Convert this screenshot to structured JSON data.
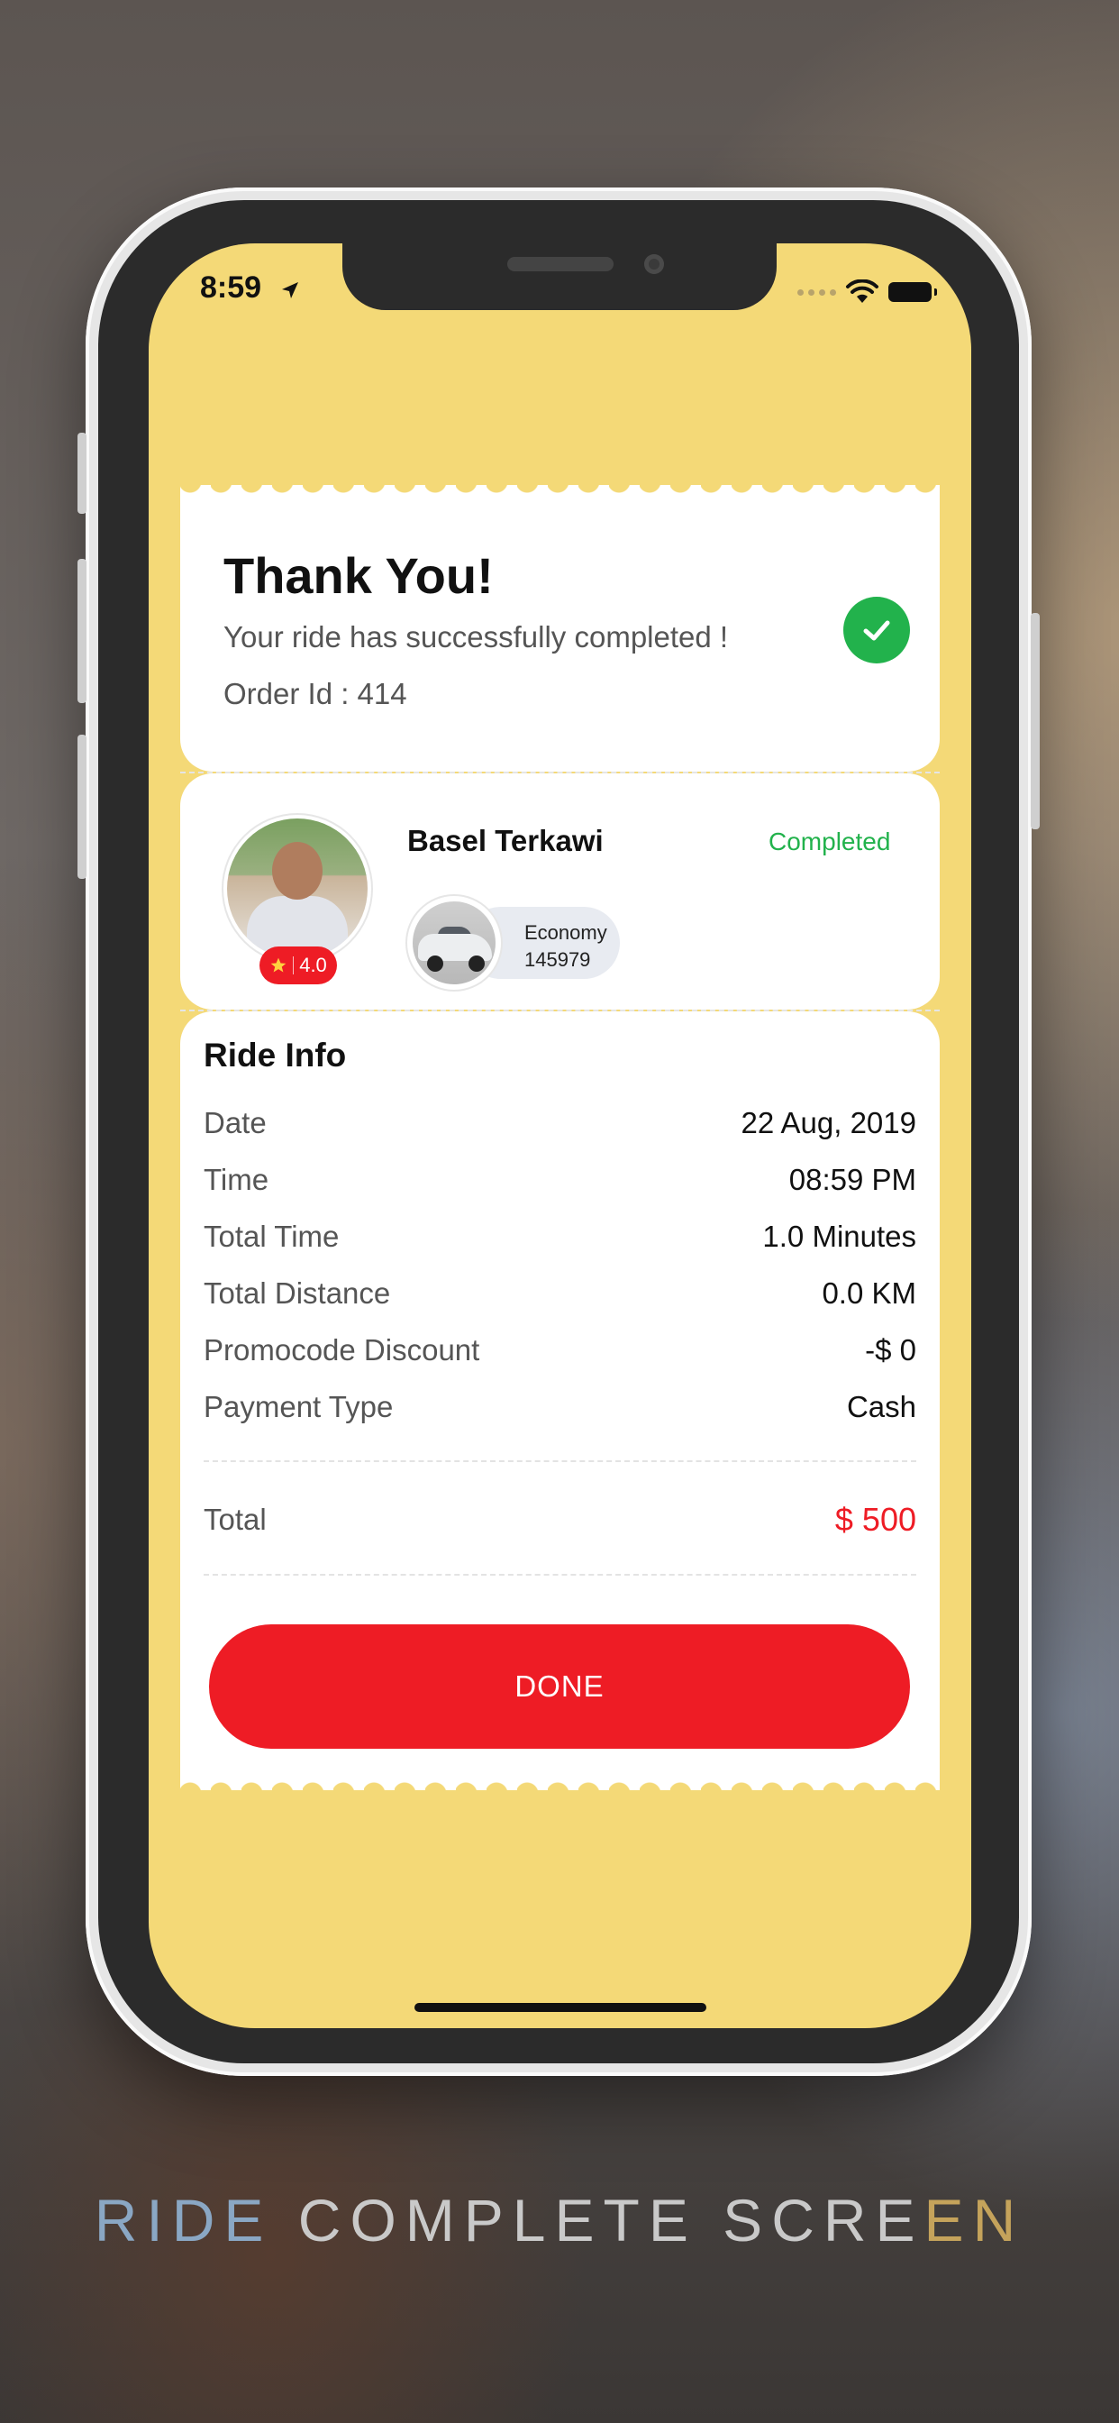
{
  "status_bar": {
    "time": "8:59"
  },
  "thank_you": {
    "title": "Thank You!",
    "subtitle": "Your ride has successfully completed !",
    "order_id": "Order Id : 414"
  },
  "driver": {
    "name": "Basel Terkawi",
    "rating": "4.0",
    "status": "Completed",
    "vehicle_type": "Economy",
    "vehicle_number": "145979"
  },
  "ride_info": {
    "title": "Ride Info",
    "rows": [
      {
        "label": "Date",
        "value": "22 Aug, 2019"
      },
      {
        "label": "Time",
        "value": "08:59 PM"
      },
      {
        "label": "Total Time",
        "value": "1.0 Minutes"
      },
      {
        "label": "Total Distance",
        "value": "0.0 KM"
      },
      {
        "label": "Promocode Discount",
        "value": "-$ 0"
      },
      {
        "label": "Payment Type",
        "value": "Cash"
      }
    ],
    "total_label": "Total",
    "total_value": "$ 500"
  },
  "done_button": "DONE",
  "caption": {
    "part1": "RIDE",
    "part2": " COMPLETE SCRE",
    "part3": "EN"
  },
  "colors": {
    "accent": "#ee1c25",
    "success": "#22b24c",
    "background": "#f4d977"
  },
  "icons": [
    "location-arrow-icon",
    "wifi-icon",
    "battery-icon",
    "checkmark-icon",
    "star-icon"
  ]
}
